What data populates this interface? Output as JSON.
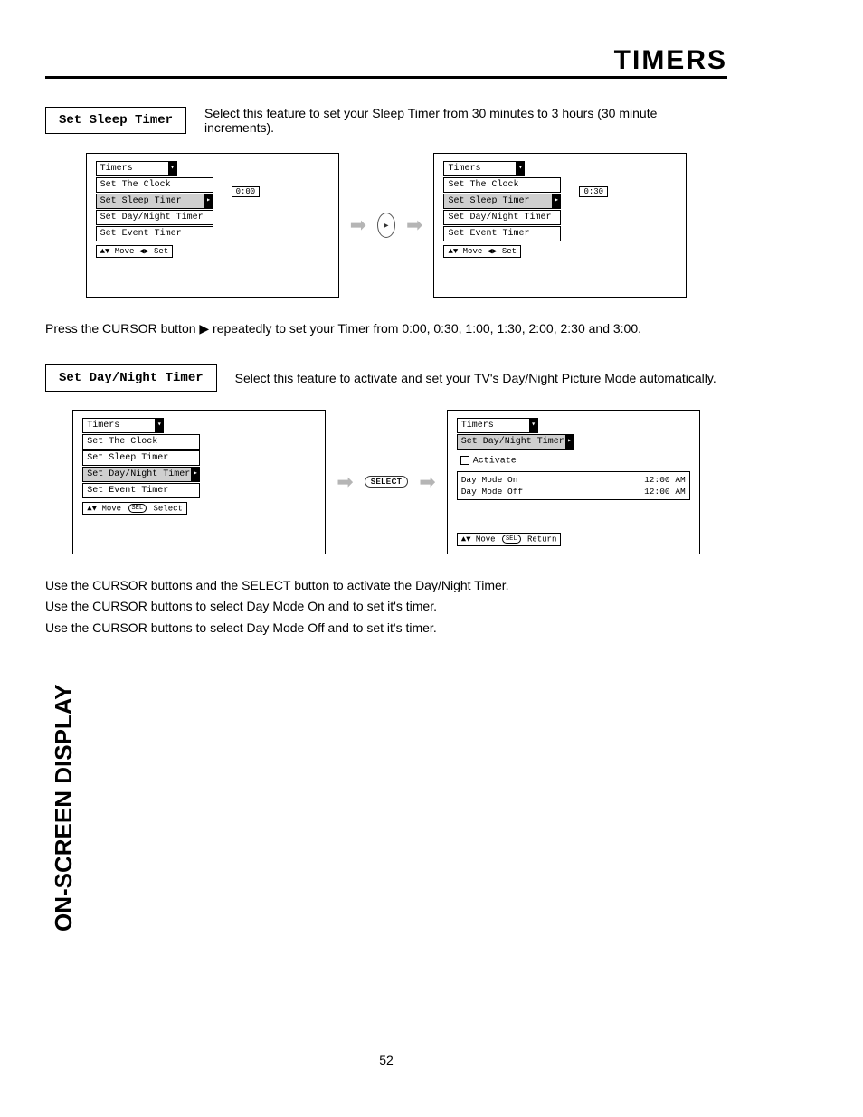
{
  "page_title": "TIMERS",
  "sidebar_label": "ON-SCREEN DISPLAY",
  "page_number": "52",
  "section1": {
    "label": "Set Sleep Timer",
    "desc": "Select this feature to set your Sleep Timer from 30 minutes to 3 hours (30 minute increments).",
    "instruction": "Press the CURSOR button ▶ repeatedly to set your Timer from 0:00, 0:30, 1:00, 1:30, 2:00, 2:30 and 3:00."
  },
  "section2": {
    "label": "Set Day/Night Timer",
    "desc": "Select this feature to activate and set your TV's Day/Night Picture Mode automatically.",
    "instructions": [
      "Use the CURSOR buttons and the SELECT button to activate the Day/Night Timer.",
      "Use the CURSOR buttons to select Day Mode On and to set it's timer.",
      "Use the CURSOR buttons to select Day Mode Off and to set it's timer."
    ]
  },
  "menus": {
    "timers_title": "Timers",
    "items": {
      "set_clock": "Set The Clock",
      "set_sleep": "Set Sleep Timer",
      "set_dn": "Set Day/Night Timer",
      "set_event": "Set Event Timer"
    },
    "hints": {
      "move_set": "▲▼ Move   ◀▶ Set",
      "move_select": "▲▼ Move  (SEL) Select",
      "move_return": "▲▼ Move   (SEL) Return"
    },
    "values": {
      "v000": "0:00",
      "v030": "0:30"
    },
    "dn_screen": {
      "activate": "Activate",
      "on_label": "Day Mode On",
      "off_label": "Day Mode Off",
      "on_time": "12:00 AM",
      "off_time": "12:00 AM"
    },
    "select_btn": "SELECT"
  }
}
